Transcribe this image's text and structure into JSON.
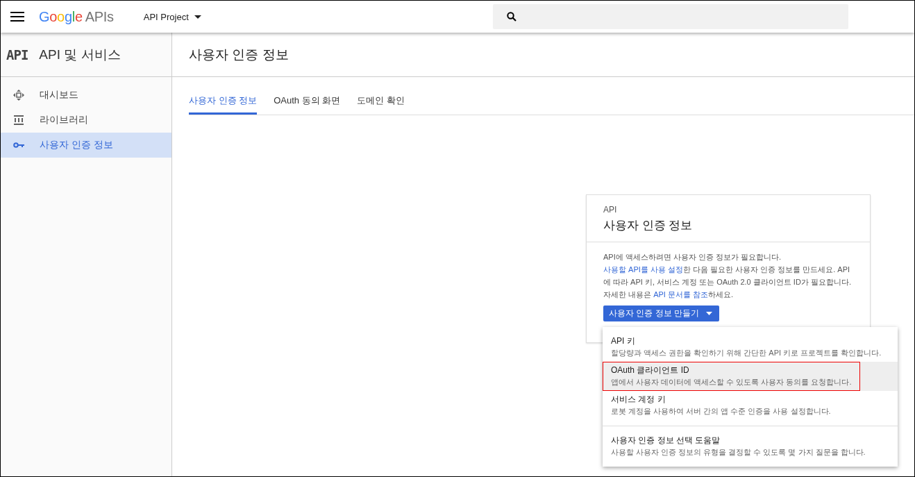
{
  "header": {
    "logo": {
      "brand": "Google",
      "product": "APIs"
    },
    "project": "API Project"
  },
  "sidebar": {
    "title_icon": "API",
    "title": "API 및 서비스",
    "items": [
      {
        "label": "대시보드",
        "selected": false
      },
      {
        "label": "라이브러리",
        "selected": false
      },
      {
        "label": "사용자 인증 정보",
        "selected": true
      }
    ]
  },
  "page": {
    "title": "사용자 인증 정보",
    "tabs": [
      {
        "label": "사용자 인증 정보",
        "selected": true
      },
      {
        "label": "OAuth 동의 화면",
        "selected": false
      },
      {
        "label": "도메인 확인",
        "selected": false
      }
    ]
  },
  "card": {
    "eyebrow": "API",
    "title": "사용자 인증 정보",
    "description": [
      {
        "kind": "text",
        "text": "API에 액세스하려면 사용자 인증 정보가 필요합니다. "
      },
      {
        "kind": "link",
        "text": "사용할 API를 사용 설정"
      },
      {
        "kind": "text",
        "text": "한 다음 필요한 사용자 인증 정보를 만드세요. API에 따라 API 키, 서비스 계정 또는 OAuth 2.0 클라이언트 ID가 필요합니다. 자세한 내용은 "
      },
      {
        "kind": "link",
        "text": "API 문서를 참조"
      },
      {
        "kind": "text",
        "text": "하세요."
      }
    ],
    "button": "사용자 인증 정보 만들기"
  },
  "menu": {
    "items": [
      {
        "title": "API 키",
        "description": "할당량과 액세스 권한을 확인하기 위해 간단한 API 키로 프로젝트를 확인합니다.",
        "highlighted": false,
        "divider_before": false
      },
      {
        "title": "OAuth 클라이언트 ID",
        "description": "앱에서 사용자 데이터에 액세스할 수 있도록 사용자 동의를 요청합니다.",
        "highlighted": true,
        "divider_before": false
      },
      {
        "title": "서비스 계정 키",
        "description": "로봇 계정을 사용하여 서버 간의 앱 수준 인증을 사용 설정합니다.",
        "highlighted": false,
        "divider_before": false
      },
      {
        "title": "사용자 인증 정보 선택 도움말",
        "description": "사용할 사용자 인증 정보의 유형을 결정할 수 있도록 몇 가지 질문을 합니다.",
        "highlighted": false,
        "divider_before": true
      }
    ]
  }
}
